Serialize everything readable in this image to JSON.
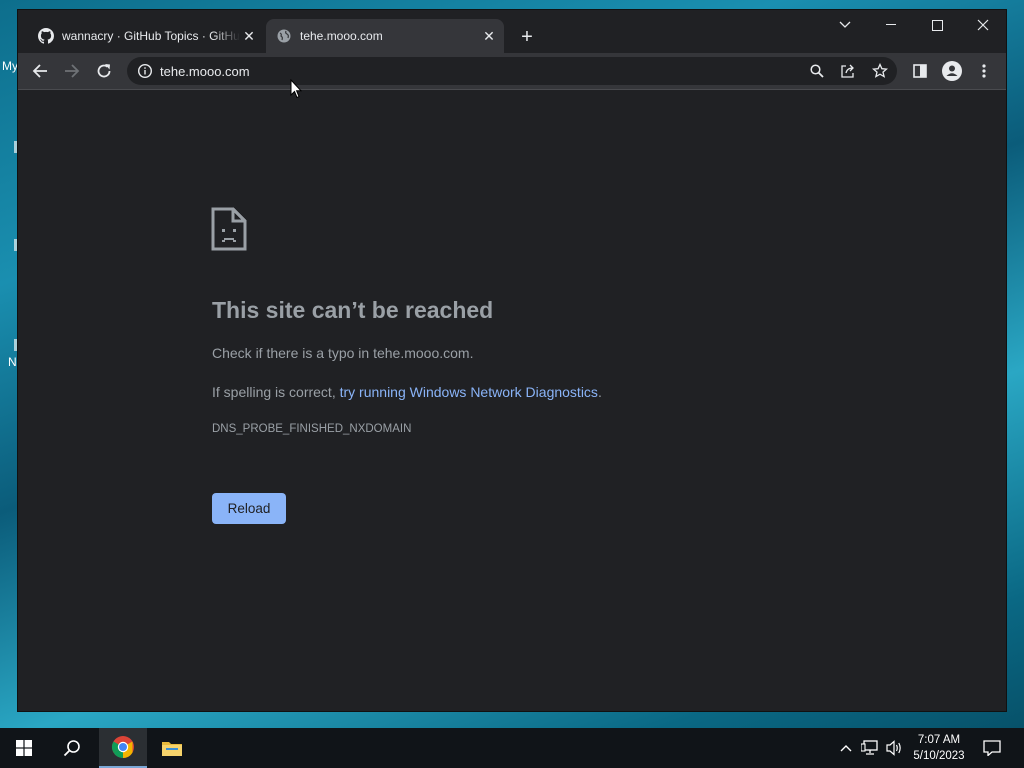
{
  "desktop": {
    "fragments": [
      "My",
      "N"
    ]
  },
  "browser": {
    "tabs": [
      {
        "title": "wannacry · GitHub Topics · GitHub",
        "favicon": "github-icon",
        "active": false
      },
      {
        "title": "tehe.mooo.com",
        "favicon": "globe-icon",
        "active": true
      }
    ],
    "address": "tehe.mooo.com"
  },
  "error_page": {
    "title": "This site can’t be reached",
    "typo_hint": "Check if there is a typo in tehe.mooo.com.",
    "spelling_prefix": "If spelling is correct, ",
    "diagnostics_link": "try running Windows Network Diagnostics",
    "spelling_suffix": ".",
    "error_code": "DNS_PROBE_FINISHED_NXDOMAIN",
    "reload_label": "Reload"
  },
  "taskbar": {
    "time": "7:07 AM",
    "date": "5/10/2023"
  },
  "colors": {
    "link": "#8ab4f8",
    "button": "#8ab4f8",
    "page_bg": "#202124"
  }
}
